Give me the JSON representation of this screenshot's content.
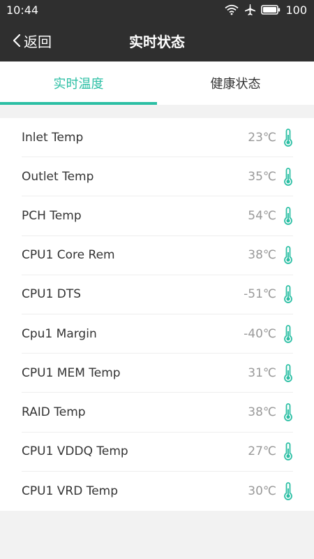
{
  "status_bar": {
    "time": "10:44",
    "icons": [
      "wifi-icon",
      "airplane-icon",
      "battery-icon"
    ],
    "battery": "100"
  },
  "app_bar": {
    "back_label": "返回",
    "title": "实时状态"
  },
  "tabs": [
    {
      "label": "实时温度",
      "active": true
    },
    {
      "label": "健康状态",
      "active": false
    }
  ],
  "sensors": [
    {
      "name": "Inlet Temp",
      "value": "23℃"
    },
    {
      "name": "Outlet Temp",
      "value": "35℃"
    },
    {
      "name": "PCH Temp",
      "value": "54℃"
    },
    {
      "name": "CPU1 Core Rem",
      "value": "38℃"
    },
    {
      "name": "CPU1 DTS",
      "value": "-51℃"
    },
    {
      "name": "Cpu1 Margin",
      "value": "-40℃"
    },
    {
      "name": "CPU1 MEM Temp",
      "value": "31℃"
    },
    {
      "name": "RAID Temp",
      "value": "38℃"
    },
    {
      "name": "CPU1 VDDQ Temp",
      "value": "27℃"
    },
    {
      "name": "CPU1 VRD Temp",
      "value": "30℃"
    }
  ],
  "colors": {
    "accent": "#2bbfa4",
    "bar_background": "#2f2f2f",
    "page_background": "#f2f2f2"
  }
}
